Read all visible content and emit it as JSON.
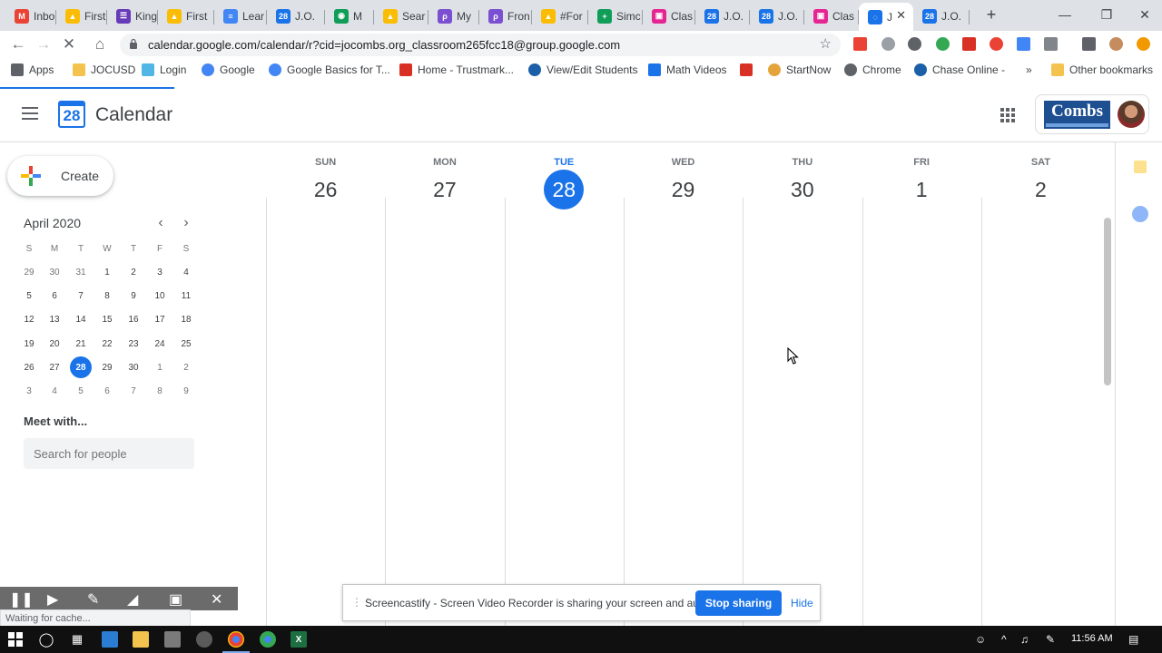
{
  "browser": {
    "tabs": [
      {
        "label": "Inbo",
        "icon": "gmail-icon",
        "color": "#ea4335",
        "glyph": "M",
        "active": false
      },
      {
        "label": "First",
        "icon": "google-drive-icon",
        "color": "#fbbc04",
        "glyph": "▲",
        "active": false
      },
      {
        "label": "King",
        "icon": "google-forms-icon",
        "color": "#673ab7",
        "glyph": "☰",
        "active": false
      },
      {
        "label": "First",
        "icon": "google-drive-icon",
        "color": "#fbbc04",
        "glyph": "▲",
        "active": false
      },
      {
        "label": "Lear",
        "icon": "google-docs-icon",
        "color": "#4285f4",
        "glyph": "≡",
        "active": false
      },
      {
        "label": "J.O.",
        "icon": "google-calendar-icon",
        "color": "#1a73e8",
        "glyph": "28",
        "active": false
      },
      {
        "label": "M",
        "icon": "screencastify-icon",
        "color": "#0f9d58",
        "glyph": "◉",
        "active": false
      },
      {
        "label": "Sear",
        "icon": "google-drive-icon",
        "color": "#fbbc04",
        "glyph": "▲",
        "active": false
      },
      {
        "label": "My",
        "icon": "flipgrid-icon",
        "color": "#7b4fd1",
        "glyph": "ρ",
        "active": false
      },
      {
        "label": "Fron",
        "icon": "flipgrid-icon",
        "color": "#7b4fd1",
        "glyph": "ρ",
        "active": false
      },
      {
        "label": "#For",
        "icon": "google-drive-icon",
        "color": "#fbbc04",
        "glyph": "▲",
        "active": false
      },
      {
        "label": "Simc",
        "icon": "google-sheets-icon",
        "color": "#0f9d58",
        "glyph": "+",
        "active": false
      },
      {
        "label": "Clas",
        "icon": "google-classroom-icon",
        "color": "#e52592",
        "glyph": "▣",
        "active": false
      },
      {
        "label": "J.O.",
        "icon": "google-calendar-icon",
        "color": "#1a73e8",
        "glyph": "28",
        "active": false
      },
      {
        "label": "J.O.",
        "icon": "google-calendar-icon",
        "color": "#1a73e8",
        "glyph": "28",
        "active": false
      },
      {
        "label": "Clas",
        "icon": "google-classroom-icon",
        "color": "#e52592",
        "glyph": "▣",
        "active": false
      },
      {
        "label": "J",
        "icon": "loading-icon",
        "color": "#1a73e8",
        "glyph": "◌",
        "active": true
      },
      {
        "label": "J.O.",
        "icon": "google-calendar-icon",
        "color": "#1a73e8",
        "glyph": "28",
        "active": false
      }
    ],
    "new_tab_glyph": "+",
    "url": "calendar.google.com/calendar/r?cid=jocombs.org_classroom265fcc18@group.google.com",
    "bookmarks": [
      {
        "label": "Apps",
        "icon": "apps-grid-icon",
        "color": "#5f6368"
      },
      {
        "label": "JOCUSD",
        "icon": "folder-icon",
        "color": "#f3c34d"
      },
      {
        "label": "Login",
        "icon": "cloud-icon",
        "color": "#4fb6e6"
      },
      {
        "label": "Google",
        "icon": "google-g-icon",
        "color": "#4285f4"
      },
      {
        "label": "Google Basics for T...",
        "icon": "google-g-icon",
        "color": "#4285f4"
      },
      {
        "label": "Home - Trustmark...",
        "icon": "trustmark-icon",
        "color": "#d93025"
      },
      {
        "label": "View/Edit Students",
        "icon": "globe-icon",
        "color": "#1a5fa8"
      },
      {
        "label": "Math Videos",
        "icon": "star-icon",
        "color": "#1a73e8"
      },
      {
        "label": "",
        "icon": "dots-icon",
        "color": "#d93025"
      },
      {
        "label": "StartNow",
        "icon": "startnow-icon",
        "color": "#e5a33b"
      },
      {
        "label": "Chrome",
        "icon": "globe-icon",
        "color": "#5f6368"
      },
      {
        "label": "Chase Online -",
        "icon": "chase-icon",
        "color": "#1a5fa8"
      }
    ],
    "bookmarks_overflow": "»",
    "other_bookmarks": "Other bookmarks",
    "status_text": "Waiting for cache..."
  },
  "calendar": {
    "app_title": "Calendar",
    "logo_day": "28",
    "create_label": "Create",
    "org_logo_text": "Combs",
    "mini": {
      "title": "April 2020",
      "prev": "‹",
      "next": "›",
      "dows": [
        "S",
        "M",
        "T",
        "W",
        "T",
        "F",
        "S"
      ],
      "weeks": [
        [
          "29",
          "30",
          "31",
          "1",
          "2",
          "3",
          "4"
        ],
        [
          "5",
          "6",
          "7",
          "8",
          "9",
          "10",
          "11"
        ],
        [
          "12",
          "13",
          "14",
          "15",
          "16",
          "17",
          "18"
        ],
        [
          "19",
          "20",
          "21",
          "22",
          "23",
          "24",
          "25"
        ],
        [
          "26",
          "27",
          "28",
          "29",
          "30",
          "1",
          "2"
        ],
        [
          "3",
          "4",
          "5",
          "6",
          "7",
          "8",
          "9"
        ]
      ],
      "today_week": 4,
      "today_day": 2
    },
    "meet_with": "Meet with...",
    "people_placeholder": "Search for people",
    "week": [
      {
        "dow": "SUN",
        "num": "26"
      },
      {
        "dow": "MON",
        "num": "27"
      },
      {
        "dow": "TUE",
        "num": "28",
        "today": true
      },
      {
        "dow": "WED",
        "num": "29"
      },
      {
        "dow": "THU",
        "num": "30"
      },
      {
        "dow": "FRI",
        "num": "1"
      },
      {
        "dow": "SAT",
        "num": "2"
      }
    ]
  },
  "screencastify": {
    "message": "Screencastify - Screen Video Recorder is sharing your screen and audio.",
    "stop_label": "Stop sharing",
    "hide_label": "Hide"
  },
  "taskbar": {
    "clock": "11:56 AM"
  },
  "colors": {
    "accent": "#1a73e8",
    "grid_line": "#dadce0"
  }
}
